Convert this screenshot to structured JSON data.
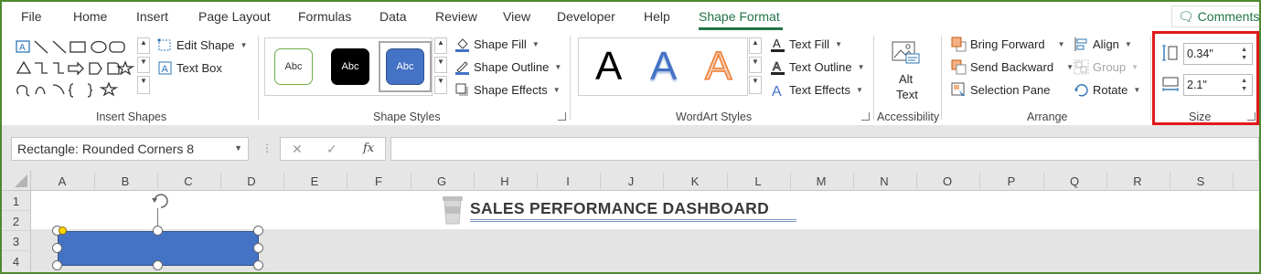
{
  "menu": {
    "tabs": [
      "File",
      "Home",
      "Insert",
      "Page Layout",
      "Formulas",
      "Data",
      "Review",
      "View",
      "Developer",
      "Help",
      "Shape Format"
    ],
    "active_tab": "Shape Format",
    "comments": "Comments"
  },
  "ribbon": {
    "insert_shapes": {
      "label": "Insert Shapes",
      "edit_shape": "Edit Shape",
      "text_box": "Text Box"
    },
    "shape_styles": {
      "label": "Shape Styles",
      "swatch_text": "Abc",
      "shape_fill": "Shape Fill",
      "shape_outline": "Shape Outline",
      "shape_effects": "Shape Effects"
    },
    "wordart_styles": {
      "label": "WordArt Styles",
      "letter": "A",
      "text_fill": "Text Fill",
      "text_outline": "Text Outline",
      "text_effects": "Text Effects"
    },
    "accessibility": {
      "label": "Accessibility",
      "alt_text_line1": "Alt",
      "alt_text_line2": "Text"
    },
    "arrange": {
      "label": "Arrange",
      "bring_forward": "Bring Forward",
      "send_backward": "Send Backward",
      "selection_pane": "Selection Pane",
      "align": "Align",
      "group": "Group",
      "rotate": "Rotate"
    },
    "size": {
      "label": "Size",
      "height": "0.34\"",
      "width": "2.1\""
    }
  },
  "formula_bar": {
    "name_box": "Rectangle: Rounded Corners 8",
    "fx": "fx",
    "cancel": "✕",
    "enter": "✓",
    "formula": ""
  },
  "grid": {
    "columns": [
      "A",
      "B",
      "C",
      "D",
      "E",
      "F",
      "G",
      "H",
      "I",
      "J",
      "K",
      "L",
      "M",
      "N",
      "O",
      "P",
      "Q",
      "R",
      "S"
    ],
    "rows": [
      "1",
      "2",
      "3",
      "4"
    ],
    "title": "SALES PERFORMANCE DASHBOARD"
  },
  "colors": {
    "accent": "#217346",
    "shape_fill": "#4472c4",
    "highlight": "#e0191b",
    "frame": "#4e8a2e"
  }
}
